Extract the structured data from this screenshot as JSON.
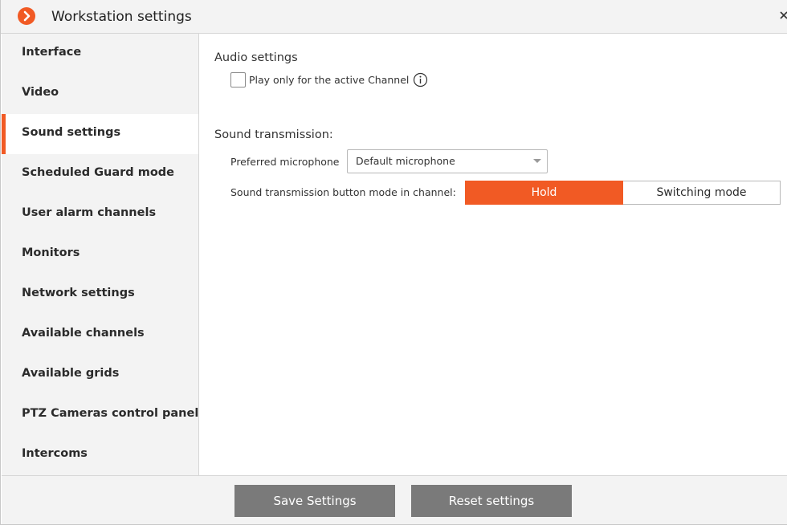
{
  "window": {
    "title": "Workstation settings"
  },
  "colors": {
    "accent": "#f15a24",
    "button_gray": "#7a7a7a",
    "sidebar_bg": "#f3f3f3"
  },
  "icons": {
    "logo": "orange-circle-chevron-icon",
    "close": "close-icon",
    "info": "info-circle-icon",
    "dropdown": "chevron-down-icon"
  },
  "sidebar": {
    "active_index": 2,
    "items": [
      {
        "label": "Interface"
      },
      {
        "label": "Video"
      },
      {
        "label": "Sound settings"
      },
      {
        "label": "Scheduled Guard mode"
      },
      {
        "label": "User alarm channels"
      },
      {
        "label": "Monitors"
      },
      {
        "label": "Network settings"
      },
      {
        "label": "Available channels"
      },
      {
        "label": "Available grids"
      },
      {
        "label": "PTZ Cameras control panel"
      },
      {
        "label": "Intercoms"
      }
    ]
  },
  "audio": {
    "section_title": "Audio settings",
    "play_active_label": "Play only for the active Channel",
    "play_active_checked": false
  },
  "transmission": {
    "section_title": "Sound transmission:",
    "microphone_label": "Preferred microphone",
    "microphone_value": "Default microphone",
    "mode_label": "Sound transmission button mode in channel:",
    "mode_options": [
      "Hold",
      "Switching mode"
    ],
    "mode_selected": "Hold"
  },
  "footer": {
    "save_label": "Save Settings",
    "reset_label": "Reset settings"
  }
}
